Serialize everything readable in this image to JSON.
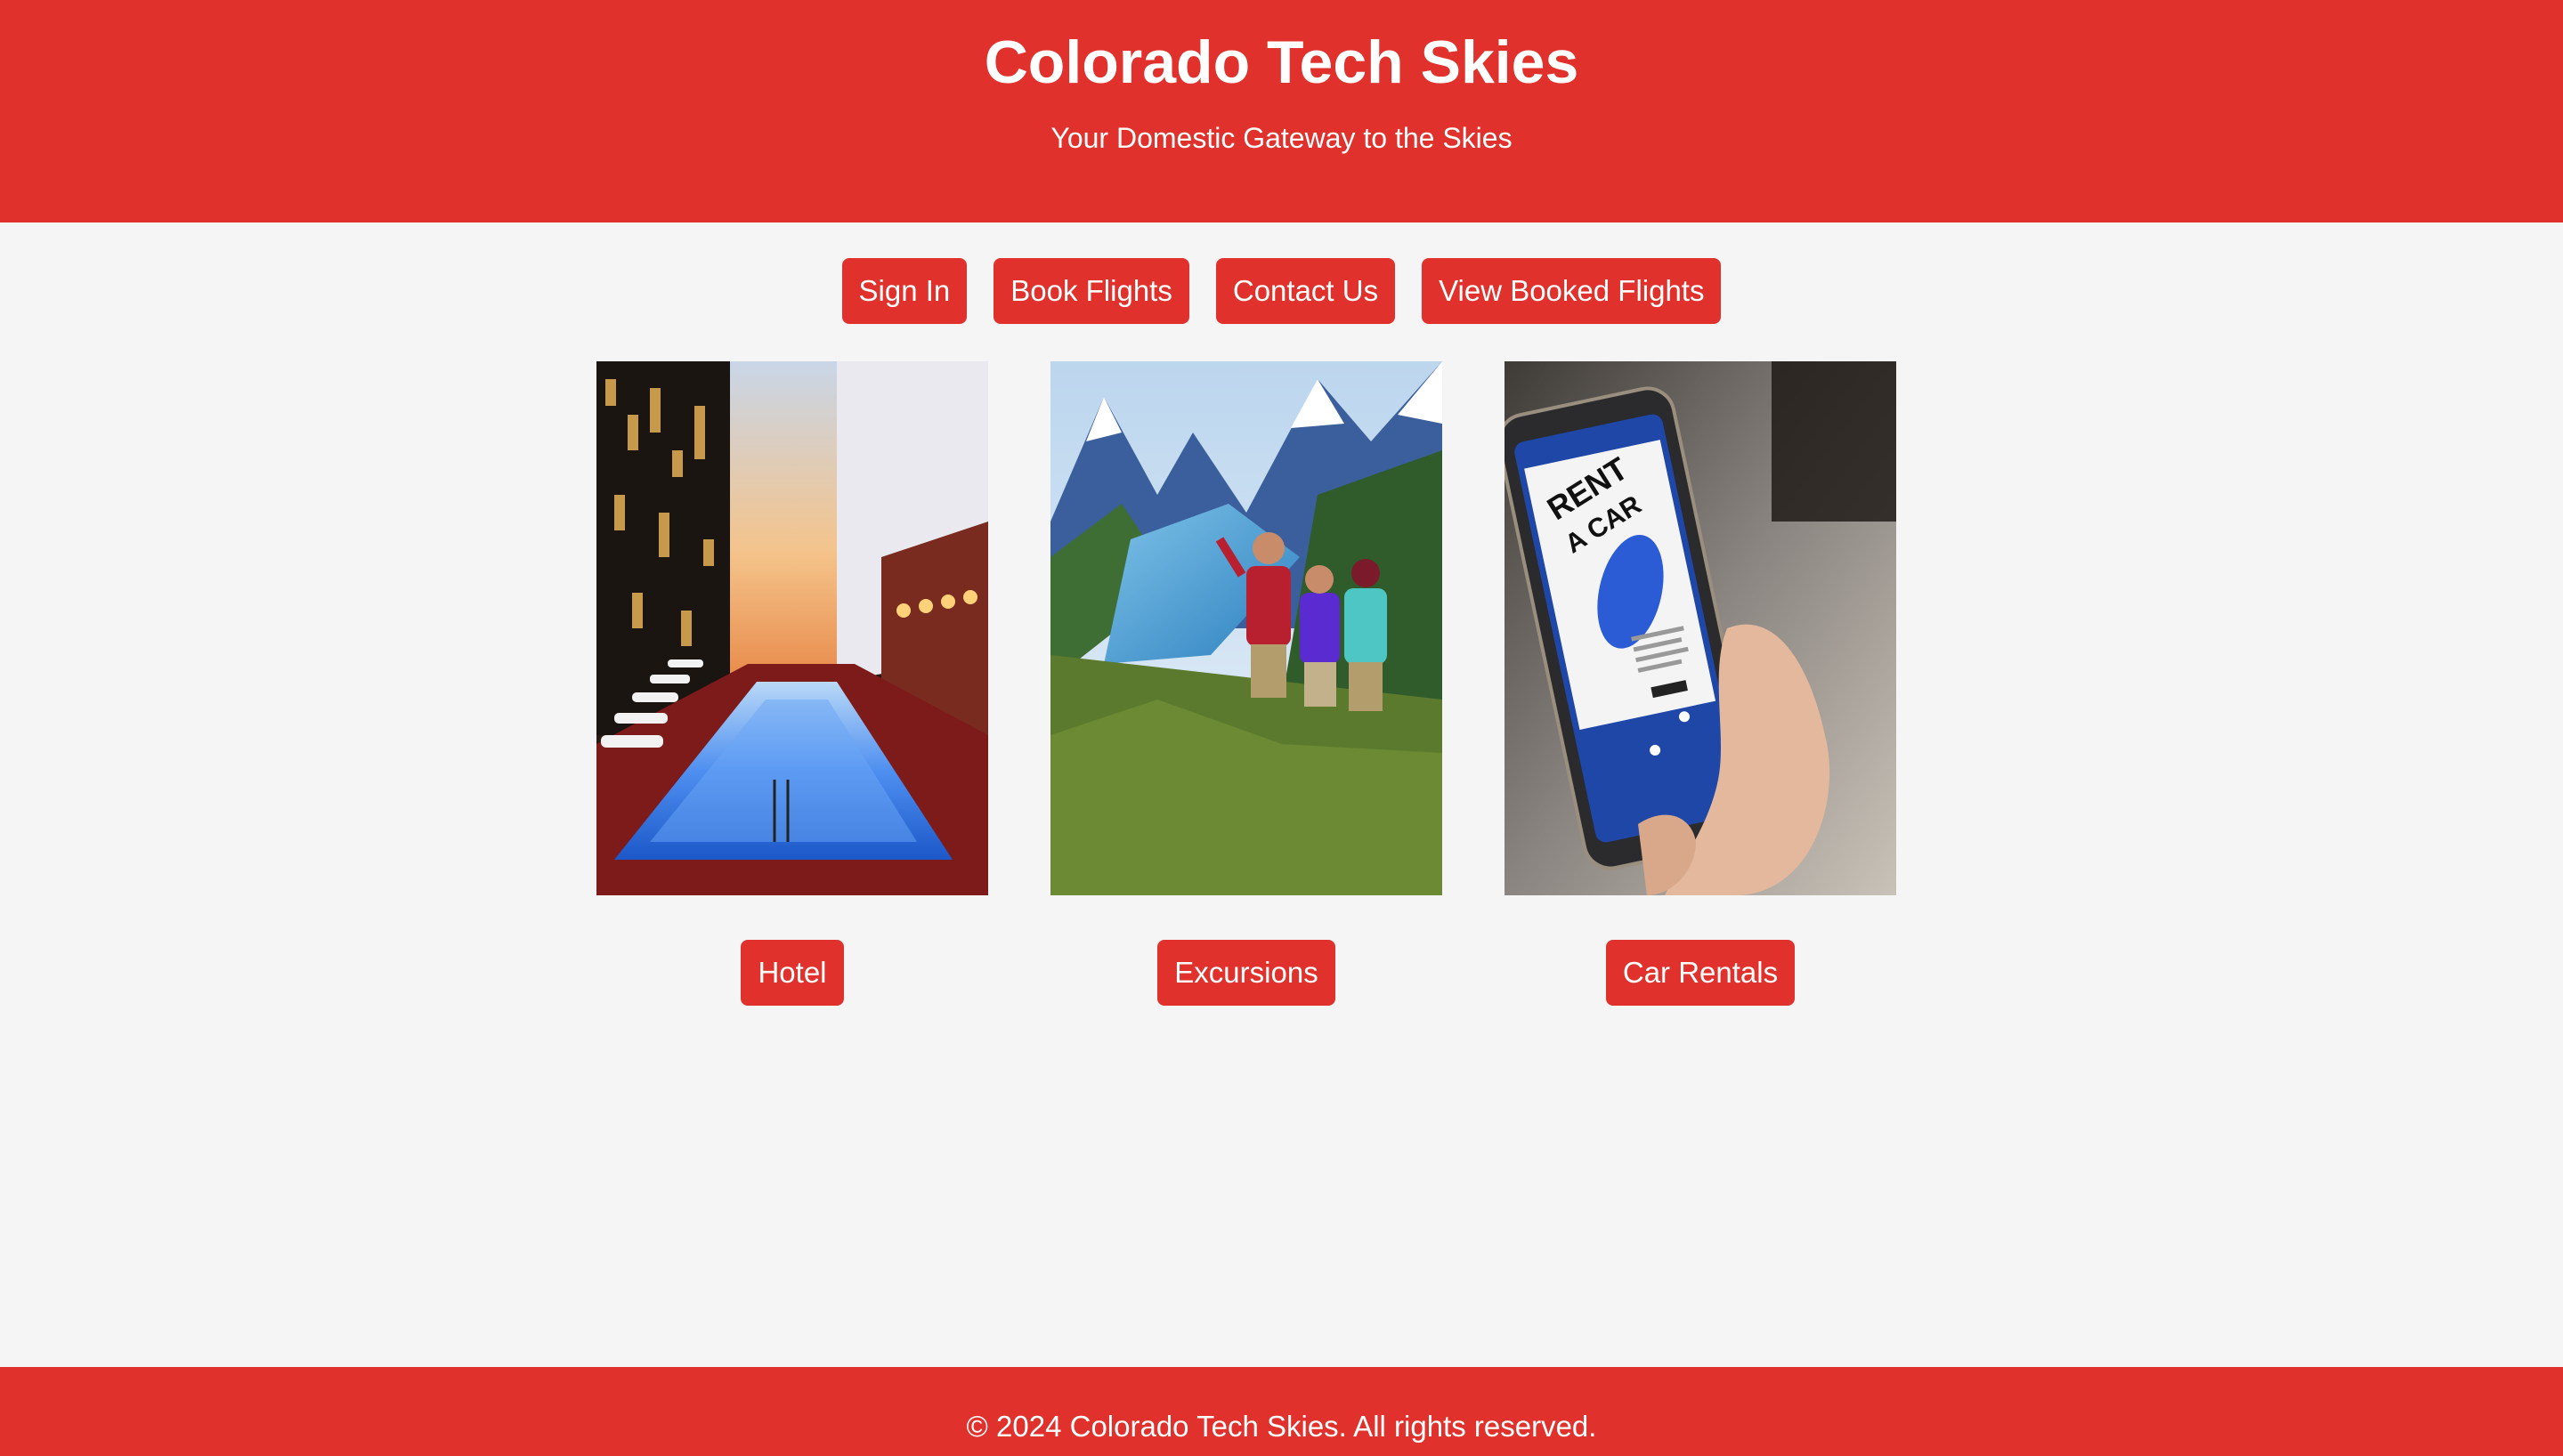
{
  "header": {
    "title": "Colorado Tech Skies",
    "tagline": "Your Domestic Gateway to the Skies"
  },
  "nav": {
    "sign_in": "Sign In",
    "book_flights": "Book Flights",
    "contact_us": "Contact Us",
    "view_booked": "View Booked Flights"
  },
  "services": {
    "hotel": "Hotel",
    "excursions": "Excursions",
    "car_rentals": "Car Rentals"
  },
  "phone_screen": {
    "line1": "RENT",
    "line2": "A CAR"
  },
  "footer": {
    "text": "© 2024 Colorado Tech Skies. All rights reserved."
  },
  "colors": {
    "brand_red": "#e0312c",
    "background": "#f5f5f5",
    "text_on_brand": "#ffffff"
  }
}
